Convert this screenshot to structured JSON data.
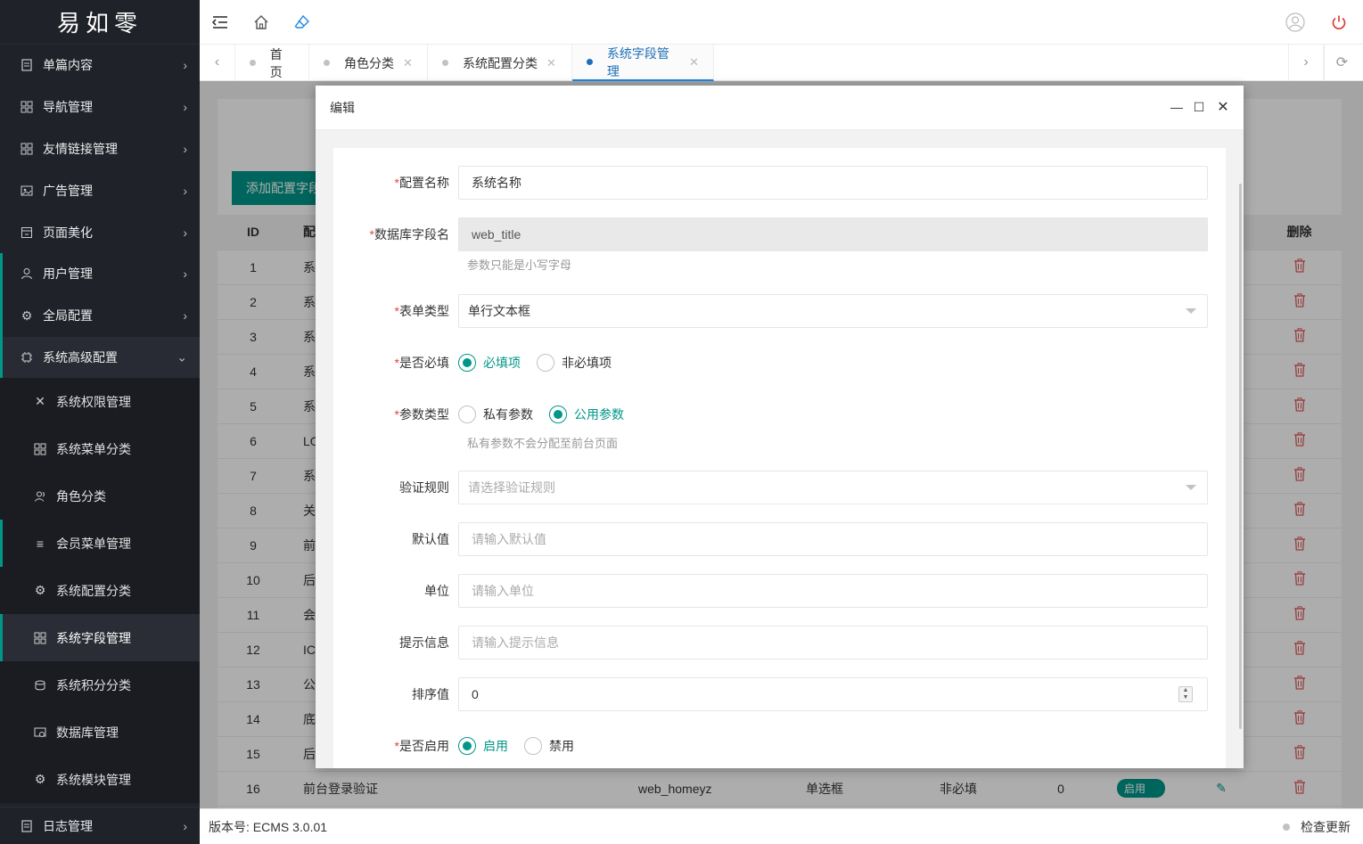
{
  "app": {
    "logo_text": "易如零"
  },
  "sidebar": {
    "items": [
      {
        "label": "单篇内容",
        "icon": "document-icon"
      },
      {
        "label": "导航管理",
        "icon": "grid-icon"
      },
      {
        "label": "友情链接管理",
        "icon": "grid-icon"
      },
      {
        "label": "广告管理",
        "icon": "image-icon"
      },
      {
        "label": "页面美化",
        "icon": "page-icon"
      },
      {
        "label": "用户管理",
        "icon": "user-icon"
      },
      {
        "label": "全局配置",
        "icon": "gear-icon"
      },
      {
        "label": "系统高级配置",
        "icon": "chip-icon"
      }
    ],
    "subitems": [
      {
        "label": "系统权限管理",
        "icon": "tools-icon"
      },
      {
        "label": "系统菜单分类",
        "icon": "grid-icon"
      },
      {
        "label": "角色分类",
        "icon": "users-icon"
      },
      {
        "label": "会员菜单管理",
        "icon": "menu-icon"
      },
      {
        "label": "系统配置分类",
        "icon": "gear-icon"
      },
      {
        "label": "系统字段管理",
        "icon": "grid-icon"
      },
      {
        "label": "系统积分分类",
        "icon": "coins-icon"
      },
      {
        "label": "数据库管理",
        "icon": "database-icon"
      },
      {
        "label": "系统模块管理",
        "icon": "gear-icon"
      }
    ],
    "bottom_item": {
      "label": "日志管理",
      "icon": "document-icon"
    }
  },
  "tabs": [
    {
      "label": "首页"
    },
    {
      "label": "角色分类"
    },
    {
      "label": "系统配置分类"
    },
    {
      "label": "系统字段管理"
    }
  ],
  "background_page": {
    "add_button": "添加配置字段",
    "table": {
      "headers": {
        "id": "ID",
        "name": "配",
        "delete": "删除"
      },
      "rows": [
        {
          "id": "1",
          "name": "系"
        },
        {
          "id": "2",
          "name": "系"
        },
        {
          "id": "3",
          "name": "系"
        },
        {
          "id": "4",
          "name": "系"
        },
        {
          "id": "5",
          "name": "系"
        },
        {
          "id": "6",
          "name": "LO"
        },
        {
          "id": "7",
          "name": "系"
        },
        {
          "id": "8",
          "name": "关"
        },
        {
          "id": "9",
          "name": "前"
        },
        {
          "id": "10",
          "name": "后"
        },
        {
          "id": "11",
          "name": "会"
        },
        {
          "id": "12",
          "name": "IC"
        },
        {
          "id": "13",
          "name": "公"
        },
        {
          "id": "14",
          "name": "底"
        },
        {
          "id": "15",
          "name": "后"
        },
        {
          "id": "16",
          "name": "前台登录验证",
          "field": "web_homeyz",
          "type": "单选框",
          "required": "非必填",
          "sort": "0",
          "status": "启用"
        }
      ]
    }
  },
  "modal": {
    "title": "编辑",
    "fields": {
      "config_name": {
        "label": "配置名称",
        "value": "系统名称"
      },
      "db_field": {
        "label": "数据库字段名",
        "value": "web_title",
        "hint": "参数只能是小写字母"
      },
      "form_type": {
        "label": "表单类型",
        "value": "单行文本框"
      },
      "required": {
        "label": "是否必填",
        "options": [
          "必填项",
          "非必填项"
        ],
        "selected": "必填项"
      },
      "param_type": {
        "label": "参数类型",
        "options": [
          "私有参数",
          "公用参数"
        ],
        "selected": "公用参数",
        "hint": "私有参数不会分配至前台页面"
      },
      "validation": {
        "label": "验证规则",
        "placeholder": "请选择验证规则"
      },
      "default_value": {
        "label": "默认值",
        "placeholder": "请输入默认值"
      },
      "unit": {
        "label": "单位",
        "placeholder": "请输入单位"
      },
      "tip": {
        "label": "提示信息",
        "placeholder": "请输入提示信息"
      },
      "sort": {
        "label": "排序值",
        "value": "0"
      },
      "enabled": {
        "label": "是否启用",
        "options": [
          "启用",
          "禁用"
        ],
        "selected": "启用"
      }
    },
    "required_mark": "*"
  },
  "footer": {
    "version": "版本号: ECMS 3.0.01",
    "update": "检查更新"
  },
  "colors": {
    "accent": "#009688",
    "sidebar": "#20222a",
    "danger": "#e25b5b",
    "active_tab": "#1e6fb7"
  }
}
